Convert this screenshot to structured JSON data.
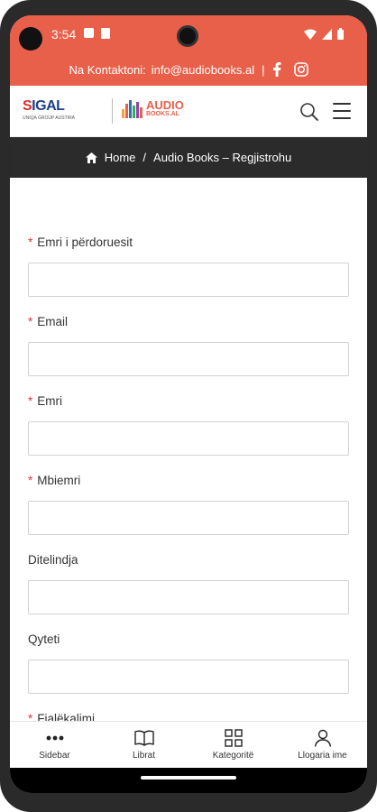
{
  "status_bar": {
    "time": "3:54"
  },
  "contact": {
    "text": "Na Kontaktoni:",
    "email": "info@audiobooks.al",
    "separator": "|"
  },
  "header": {
    "logo1_brand_prefix": "S",
    "logo1_brand_rest": "IGAL",
    "logo1_tagline": "UNIQA GROUP AUSTRIA",
    "logo2_line1": "AUDIO",
    "logo2_line2": "BOOKS.AL"
  },
  "breadcrumb": {
    "home": "Home",
    "separator": "/",
    "current": "Audio Books – Regjistrohu"
  },
  "form": {
    "fields": [
      {
        "label": "Emri i përdoruesit",
        "required": "*",
        "value": ""
      },
      {
        "label": "Email",
        "required": "*",
        "value": ""
      },
      {
        "label": "Emri",
        "required": "*",
        "value": ""
      },
      {
        "label": "Mbiemri",
        "required": "*",
        "value": ""
      },
      {
        "label": "Ditelindja",
        "required": "",
        "value": ""
      },
      {
        "label": "Qyteti",
        "required": "",
        "value": ""
      },
      {
        "label": "Fjalëkalimi",
        "required": "*",
        "value": ""
      }
    ]
  },
  "bottom_nav": {
    "items": [
      {
        "label": "Sidebar",
        "icon": "more-dots-icon"
      },
      {
        "label": "Librat",
        "icon": "book-icon"
      },
      {
        "label": "Kategoritë",
        "icon": "grid-icon"
      },
      {
        "label": "Llogaria ime",
        "icon": "user-icon"
      }
    ]
  },
  "colors": {
    "accent": "#e8604a",
    "dark_bar": "#2b2b2b",
    "required": "#d9383a"
  }
}
